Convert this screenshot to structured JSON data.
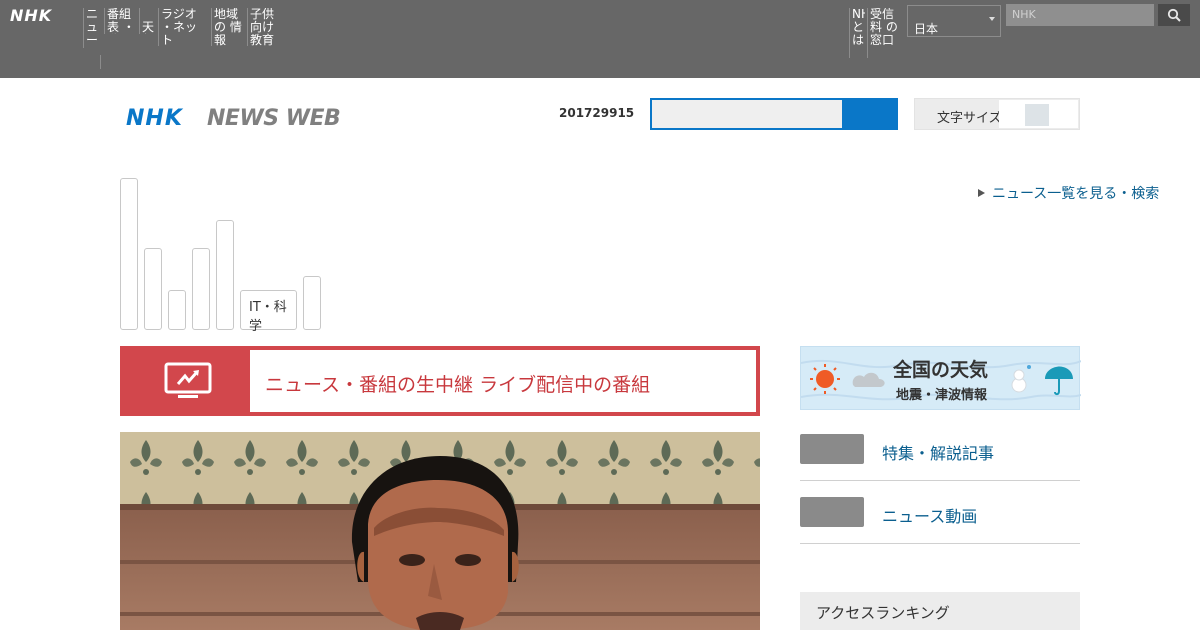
{
  "global_nav": {
    "logo": "NHK",
    "items": [
      "ニュ ース",
      "番組表 ・動画",
      "天気",
      "ラジオ ・ネット",
      "地域の 情報",
      "子供 向け教育 番組"
    ],
    "right_items": [
      "NHK とは",
      "受信料 の窓口"
    ],
    "language_select": "日本",
    "search_placeholder": "NHK"
  },
  "header": {
    "brand_nhk": "NHK",
    "brand_news": "NEWS WEB",
    "update_date": "201729915",
    "display_toggle_label": "文字サイズ"
  },
  "genres": {
    "active_tab": "IT・科学"
  },
  "more_link": "ニュース一覧を見る・検索",
  "live_banner": {
    "text": "ニュース・番組の生中継 ライブ配信中の番組"
  },
  "weather": {
    "title": "全国の天気",
    "subtitle": "地震・津波情報"
  },
  "right_column": {
    "items": [
      "特集・解説記事",
      "ニュース動画"
    ],
    "ranking_title": "アクセスランキング"
  },
  "colors": {
    "topbar": "#676767",
    "accent_blue": "#0a77c8",
    "live_red": "#d2474c",
    "link": "#0b5f8f"
  }
}
